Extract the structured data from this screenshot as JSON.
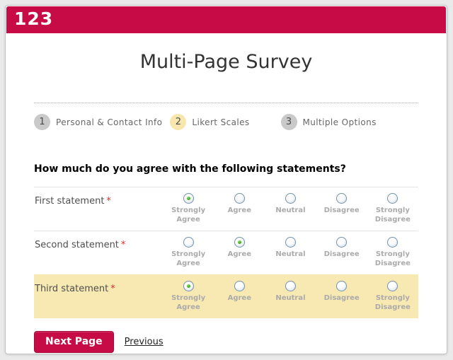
{
  "logo": {
    "text": "123"
  },
  "page": {
    "title": "Multi-Page Survey"
  },
  "steps": {
    "items": [
      {
        "number": "1",
        "label": "Personal & Contact Info",
        "active": false
      },
      {
        "number": "2",
        "label": "Likert Scales",
        "active": true
      },
      {
        "number": "3",
        "label": "Multiple Options",
        "active": false
      }
    ]
  },
  "survey": {
    "heading": "How much do you agree with the following statements?",
    "required_marker": "*",
    "options": [
      "Strongly Agree",
      "Agree",
      "Neutral",
      "Disagree",
      "Strongly Disagree"
    ],
    "rows": [
      {
        "label": "First statement",
        "required": true,
        "selected_option": "Strongly Agree",
        "values": [
          true,
          false,
          false,
          false,
          false
        ],
        "highlighted": false
      },
      {
        "label": "Second statement",
        "required": true,
        "selected_option": "Agree",
        "values": [
          false,
          true,
          false,
          false,
          false
        ],
        "highlighted": false
      },
      {
        "label": "Third statement",
        "required": true,
        "selected_option": "Strongly Agree",
        "values": [
          true,
          false,
          false,
          false,
          false
        ],
        "highlighted": true
      }
    ]
  },
  "navigation": {
    "next_label": "Next Page",
    "previous_label": "Previous"
  },
  "colors": {
    "accent": "#C60B46",
    "step_active_bg": "#F7E7AE",
    "step_inactive_bg": "#C9C9C9",
    "highlight_row_bg": "#F8E8B2",
    "radio_selected_dot": "#2FA30C"
  }
}
